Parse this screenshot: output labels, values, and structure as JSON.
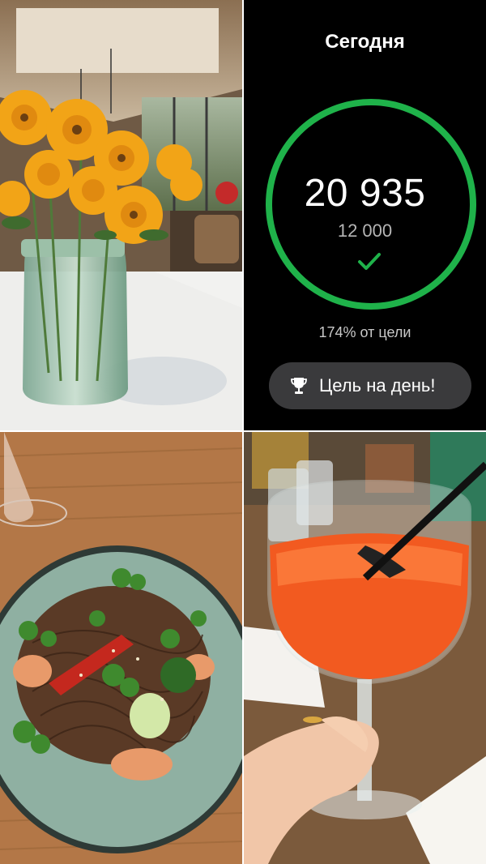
{
  "photos": {
    "top_left": "flowers-in-jar-photo",
    "bottom_left": "noodle-dish-photo",
    "bottom_right": "aperol-spritz-photo"
  },
  "steps_panel": {
    "title": "Сегодня",
    "step_count": "20 935",
    "goal": "12 000",
    "percent_text": "174% от цели",
    "button_label": "Цель на день!",
    "progress_fraction": 1.74,
    "accent_color": "#1fb24a",
    "icons": [
      "checkmark-icon",
      "trophy-icon"
    ]
  }
}
